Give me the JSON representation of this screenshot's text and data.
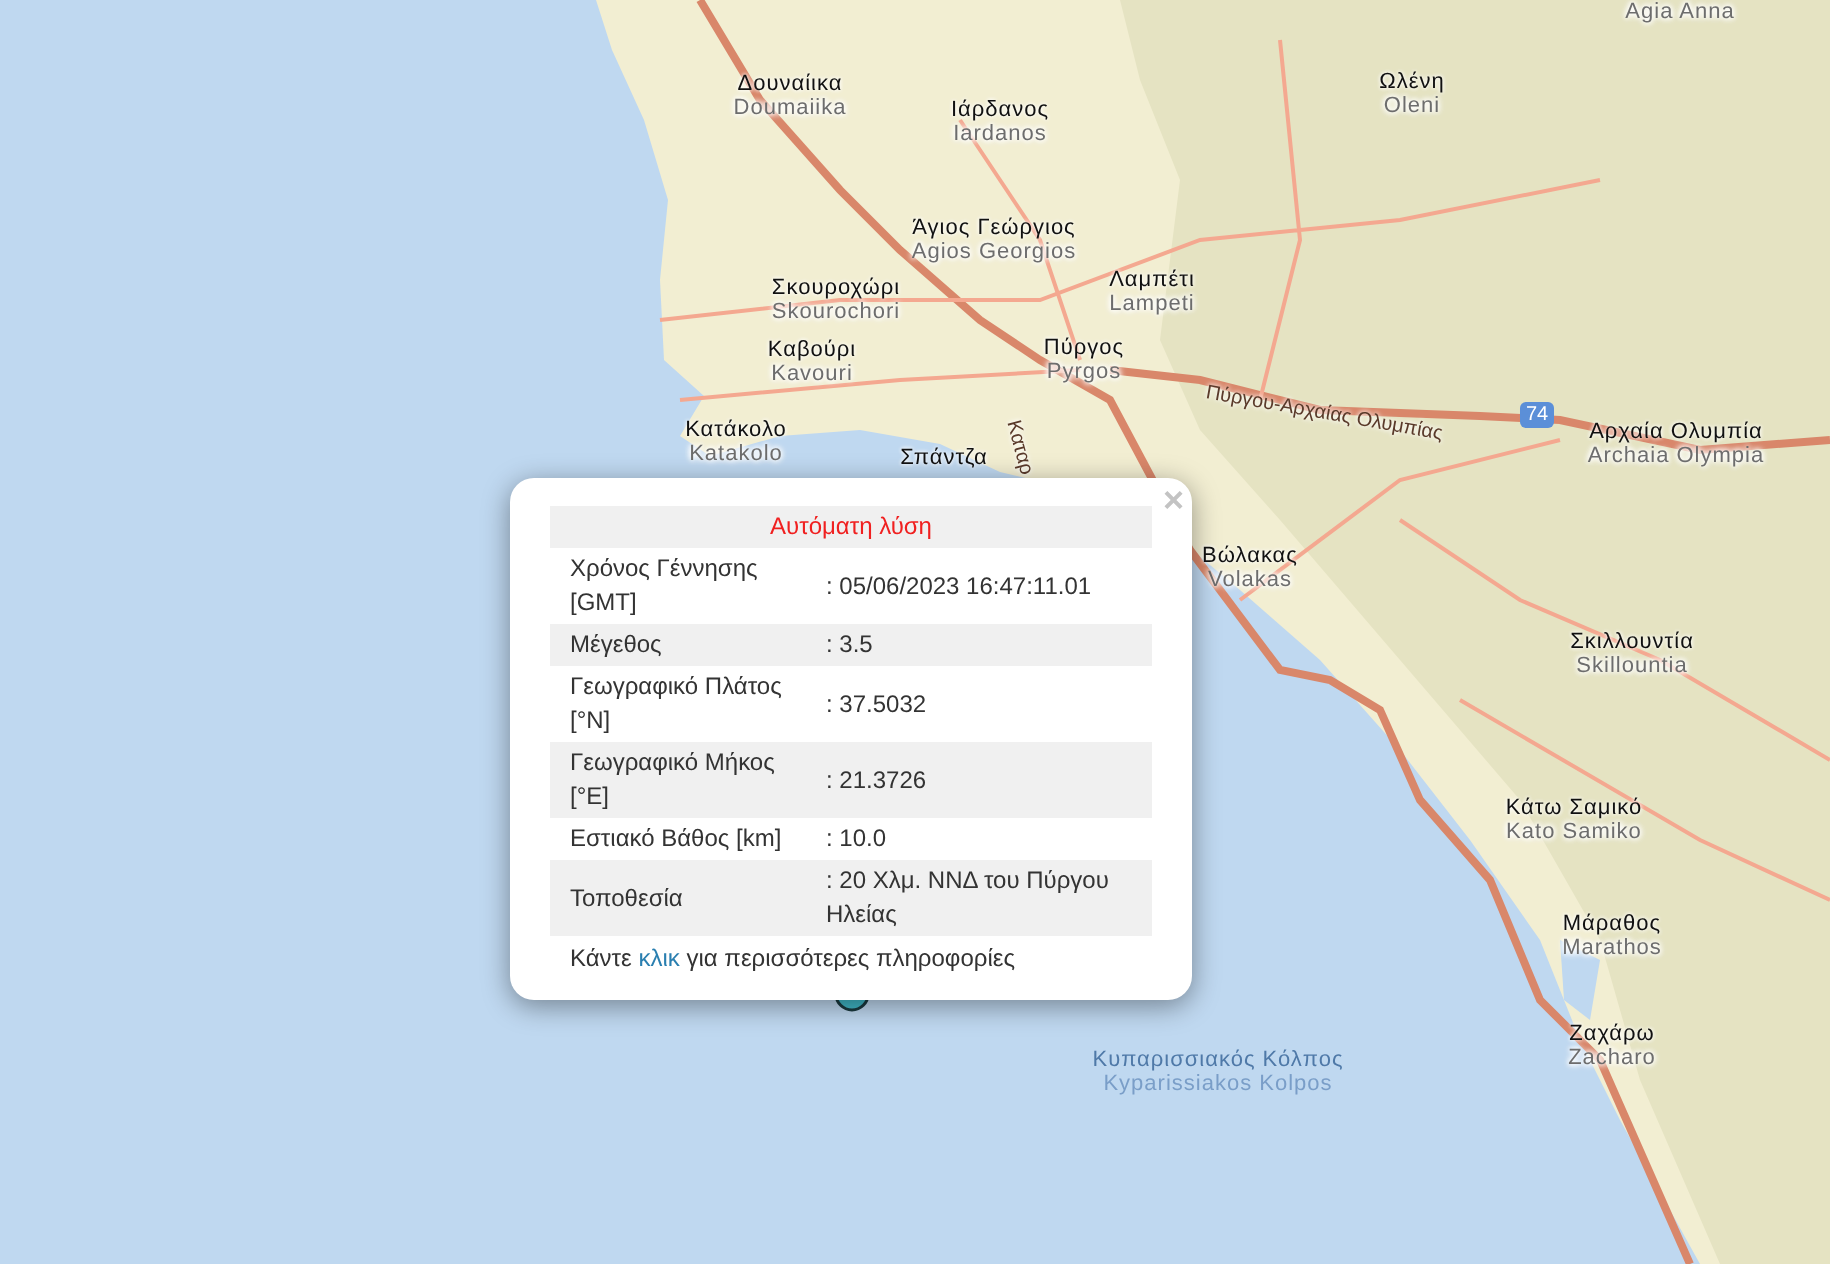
{
  "map": {
    "places": [
      {
        "greek": "Δουναίικα",
        "latin": "Doumaiika"
      },
      {
        "greek": "Ιάρδανος",
        "latin": "Iardanos"
      },
      {
        "greek": "Ωλένη",
        "latin": "Oleni"
      },
      {
        "latin": "Agia Anna"
      },
      {
        "greek": "Άγιος Γεώργιος",
        "latin": "Agios Georgios"
      },
      {
        "greek": "Σκουροχώρι",
        "latin": "Skourochori"
      },
      {
        "greek": "Λαμπέτι",
        "latin": "Lampeti"
      },
      {
        "greek": "Καβούρι",
        "latin": "Kavouri"
      },
      {
        "greek": "Πύργος",
        "latin": "Pyrgos"
      },
      {
        "greek": "Κατάκολο",
        "latin": "Katakolo"
      },
      {
        "greek": "Σπάντζα"
      },
      {
        "greek": "Αρχαία Ολυμπία",
        "latin": "Archaia Olympia"
      },
      {
        "greek": "Βώλακας",
        "latin": "Volakas"
      },
      {
        "greek": "Σκιλλουντία",
        "latin": "Skillountia"
      },
      {
        "greek": "Κάτω Σαμικό",
        "latin": "Kato Samiko"
      },
      {
        "greek": "Μάραθος",
        "latin": "Marathos"
      },
      {
        "greek": "Ζαχάρω",
        "latin": "Zacharo"
      },
      {
        "greek": "Κυπαρισσιακός Κόλπος",
        "latin": "Kyparissiakos Kolpos",
        "kind": "water"
      }
    ],
    "road_labels": [
      "Πύργου-Αρχαίας Ολυμπίας",
      "Καταρ"
    ],
    "road_shield": "74"
  },
  "popup": {
    "close": "×",
    "title": "Αυτόματη λύση",
    "rows": [
      {
        "label": "Χρόνος Γέννησης [GMT]",
        "value": ": 05/06/2023 16:47:11.01"
      },
      {
        "label": "Μέγεθος",
        "value": ": 3.5"
      },
      {
        "label": "Γεωγραφικό Πλάτος [°N]",
        "value": ": 37.5032"
      },
      {
        "label": "Γεωγραφικό Μήκος [°E]",
        "value": ": 21.3726"
      },
      {
        "label": "Εστιακό Βάθος [km]",
        "value": ": 10.0"
      },
      {
        "label": "Τοποθεσία",
        "value": ": 20 Χλμ. ΝΝΔ του Πύργου Ηλείας"
      }
    ],
    "footer": {
      "before": "Κάντε ",
      "link": "κλικ",
      "after": " για περισσότερες πληροφορίες"
    }
  }
}
